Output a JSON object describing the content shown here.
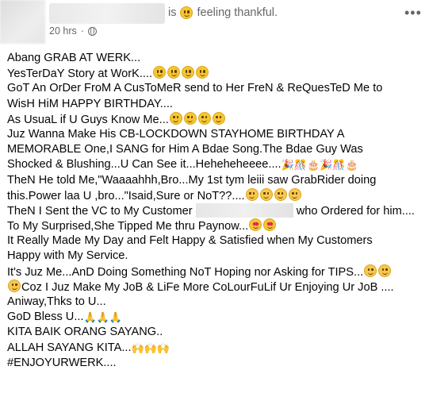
{
  "header": {
    "status_text_prefix": "is",
    "status_text_suffix": "feeling thankful.",
    "timestamp": "20 hrs",
    "separator": "·"
  },
  "post": {
    "lines": [
      "Abang GRAB AT WERK...",
      "YesTerDaY Story at WorK....",
      "GoT An OrDer FroM A CusToMeR send to Her FreN & ReQuesTeD Me to",
      "WisH HiM HAPPY BIRTHDAY....",
      "As UsuaL if U Guys Know Me...",
      "Juz Wanna Make His CB-LOCKDOWN STAYHOME BIRTHDAY A",
      "MEMORABLE One,I SANG for Him A Bdae Song.The Bdae Guy Was",
      "Shocked & Blushing...U Can See it...Heheheheeee....",
      "TheN He told Me,\"Waaaahhh,Bro...My 1st tym leiii saw GrabRider doing",
      "this.Power laa U ,bro...\"Isaid,Sure or NoT??....",
      "TheN I Sent the VC to My Customer",
      "who Ordered for him....",
      "To My Surprised,She Tipped Me thru Paynow...",
      "It Really Made My Day and Felt Happy & Satisfied when My Customers",
      "Happy with My Service.",
      "It's Juz Me...AnD Doing Something NoT Hoping nor Asking for TIPS...",
      "Coz I Juz Make My JoB & LiFe More CoLourFuLif Ur Enjoying Ur JoB ....",
      "Aniway,Thks to U...",
      "GoD Bless U...",
      "KITA BAIK ORANG SAYANG..",
      "ALLAH SAYANG KITA...",
      "#ENJOYURWERK...."
    ]
  },
  "icons": {
    "more": "more-options-icon",
    "globe": "globe-icon",
    "feeling": "smiling-emoji-icon",
    "grin": "grinning-emoji-icon",
    "party": "party-popper-icon",
    "cake": "birthday-cake-icon",
    "heart_eyes": "heart-eyes-emoji-icon",
    "blush": "blushing-emoji-icon",
    "pray": "folded-hands-icon",
    "raised_hands": "raised-hands-icon"
  },
  "colors": {
    "text": "#050505",
    "meta": "#65676b",
    "emoji": "#f7c631"
  }
}
